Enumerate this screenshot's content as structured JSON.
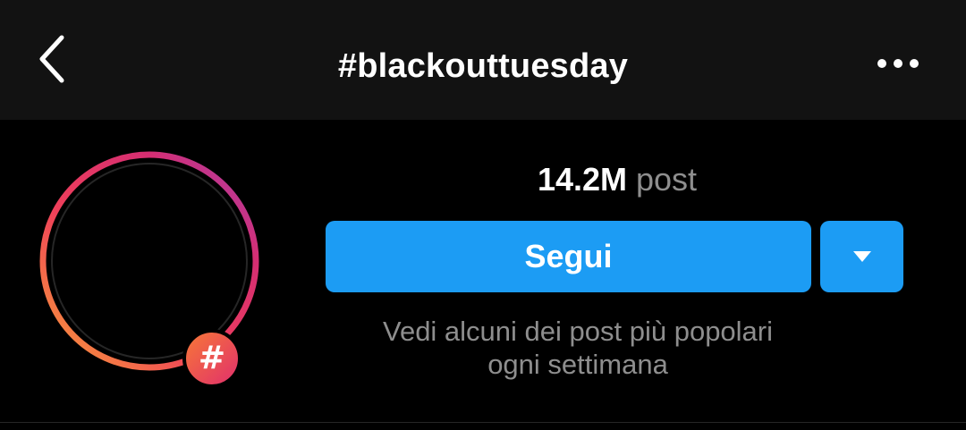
{
  "header": {
    "title": "#blackouttuesday",
    "back_icon": "chevron-left-icon",
    "more_icon": "more-horizontal-icon"
  },
  "profile": {
    "avatar_badge_glyph": "#",
    "post_count": "14.2M",
    "post_unit": "post",
    "follow_label": "Segui",
    "dropdown_icon": "triangle-down-icon",
    "description_line1": "Vedi alcuni dei post più popolari",
    "description_line2": "ogni settimana"
  },
  "colors": {
    "header_bg": "#121212",
    "page_bg": "#000000",
    "button_blue": "#1c9cf4",
    "muted_text": "#8e8e8e",
    "ring_start": "#f77737",
    "ring_mid": "#e1306c",
    "ring_end": "#c13584"
  }
}
